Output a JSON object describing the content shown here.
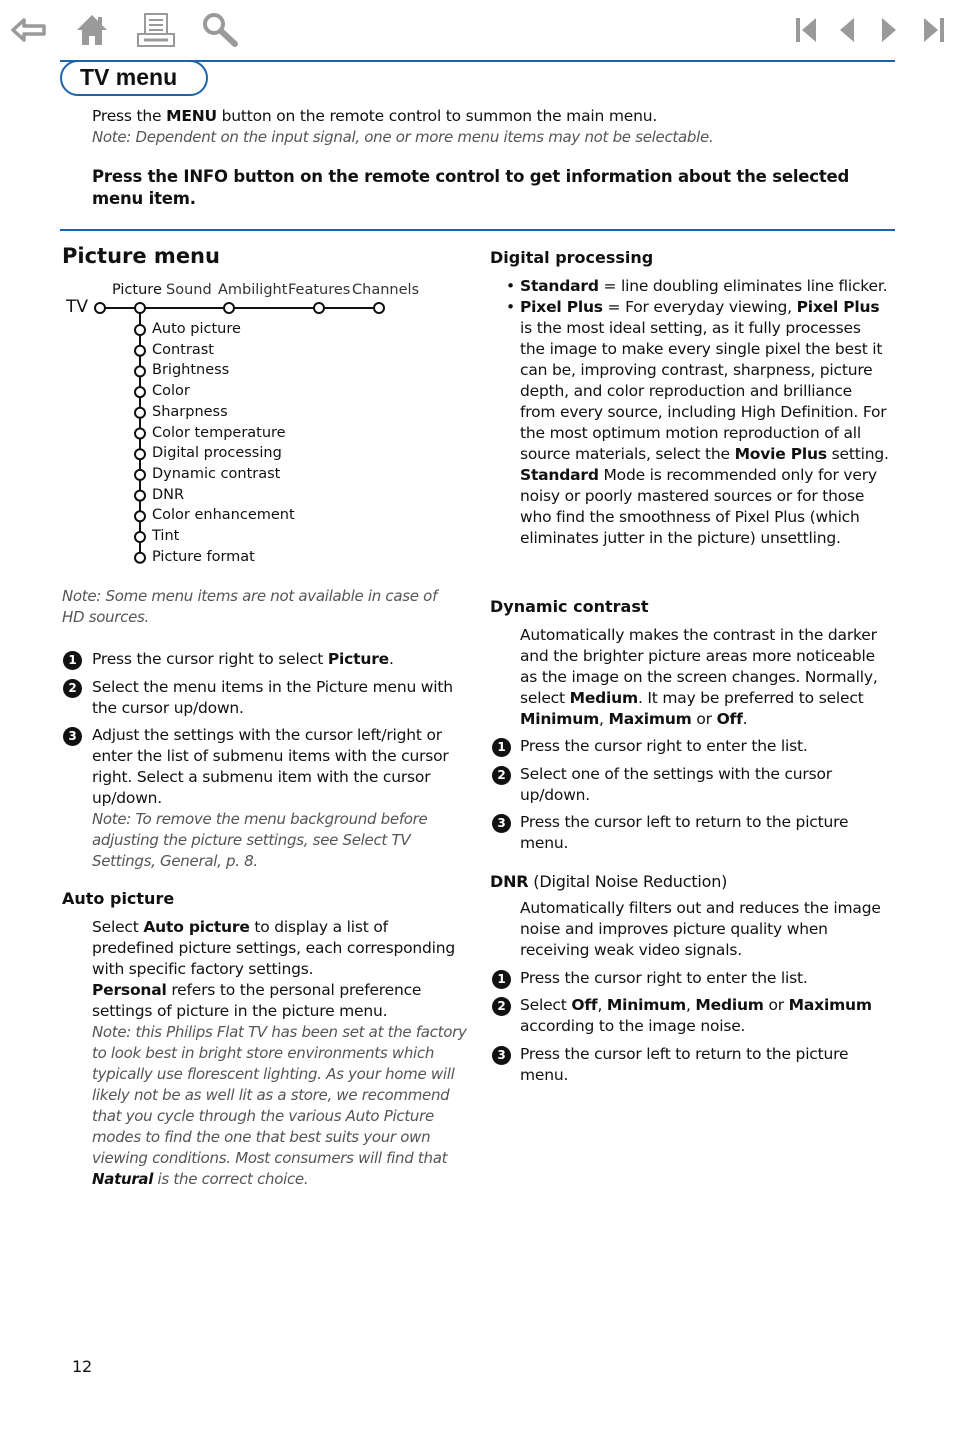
{
  "toolbar": {
    "left_icons": [
      "back-arrow-icon",
      "home-icon",
      "print-icon",
      "search-icon"
    ],
    "right_icons": [
      "first-page-icon",
      "previous-page-icon",
      "next-page-icon",
      "last-page-icon"
    ],
    "icon_color": "#9a9a9a"
  },
  "accent_color": "#1a63b0",
  "header": {
    "title": "TV menu",
    "intro_pre": "Press the ",
    "intro_key": "MENU",
    "intro_post": " button on the remote control to summon the main menu.",
    "intro_note": "Note: Dependent on the input signal, one or more menu items may not be selectable.",
    "info_text": "Press the INFO button on the remote control to get information about the selected menu item."
  },
  "picture_menu": {
    "heading": "Picture menu",
    "tree_root": "TV",
    "top_menu": [
      "Picture",
      "Sound",
      "Ambilight",
      "Features",
      "Channels"
    ],
    "items": [
      "Auto picture",
      "Contrast",
      "Brightness",
      "Color",
      "Sharpness",
      "Color temperature",
      "Digital processing",
      "Dynamic contrast",
      "DNR",
      "Color enhancement",
      "Tint",
      "Picture format"
    ],
    "note": "Note:  Some menu items are not available in case of HD sources.",
    "steps": [
      {
        "n": "1",
        "pre": "Press the cursor right to select ",
        "bold": "Picture",
        "post": "."
      },
      {
        "n": "2",
        "text": "Select the menu items in the Picture menu with the cursor up/down."
      },
      {
        "n": "3",
        "text": "Adjust the settings with the cursor left/right or enter the list of submenu items with the cursor right. Select a submenu item with the cursor up/down.",
        "note": "Note: To remove the menu background before adjusting the picture settings, see Select TV Settings, General, p. 8."
      }
    ]
  },
  "auto_picture": {
    "heading": "Auto picture",
    "p1_pre": "Select ",
    "p1_bold": "Auto picture",
    "p1_post": " to display a list of predefined picture settings, each corresponding with specific factory settings.",
    "p2_bold": "Personal",
    "p2_post": " refers to the personal preference settings of picture in the picture menu.",
    "note": "Note: this Philips Flat TV has been set at the factory to look best in bright store environments which typically use florescent lighting. As your home will likely not be as well lit as a store, we recommend that you cycle through the various Auto Picture modes to find the one that best suits your own viewing conditions. Most consumers will find that",
    "note_bold": "Natural",
    "note_post": " is the correct choice."
  },
  "digital_processing": {
    "heading": "Digital processing",
    "b1_bold": "Standard",
    "b1_text": " = line doubling eliminates line flicker.",
    "b2_bold": "Pixel Plus",
    "b2_a": " = For everyday viewing, ",
    "b2_bold2": "Pixel Plus",
    "b2_b": " is the most ideal setting, as it fully processes the image to make every single pixel the best it can be, improving contrast, sharpness, picture depth, and color reproduction and brilliance from every source, including High Definition. For the most optimum motion reproduction of all source materials, select the ",
    "b2_bold3": "Movie Plus",
    "b2_c": " setting. ",
    "b2_bold4": "Standard",
    "b2_d": " Mode is recommended only for very noisy or poorly mastered sources or for those who find the smoothness of Pixel Plus (which eliminates jutter in the picture) unsettling."
  },
  "dynamic_contrast": {
    "heading": "Dynamic contrast",
    "p_a": "Automatically makes the contrast in the darker and the brighter picture areas more noticeable as the image on the screen changes. Normally, select ",
    "p_b1": "Medium",
    "p_b": ". It may be preferred to select ",
    "p_b2": "Minimum",
    "p_c": ", ",
    "p_b3": "Maximum",
    "p_d": " or ",
    "p_b4": "Off",
    "p_e": ".",
    "steps": [
      {
        "n": "1",
        "text": "Press the cursor right to enter the list."
      },
      {
        "n": "2",
        "text": "Select one of the settings with the cursor up/down."
      },
      {
        "n": "3",
        "text": "Press the cursor left to return to the picture menu."
      }
    ]
  },
  "dnr": {
    "heading_bold": "DNR",
    "heading_rest": " (Digital Noise Reduction)",
    "p": "Automatically filters out and reduces the image noise and improves picture quality when receiving weak video signals.",
    "steps": [
      {
        "n": "1",
        "text": "Press the cursor right to enter the list."
      },
      {
        "n": "2",
        "pre": "Select ",
        "b1": "Off",
        "s1": ", ",
        "b2": "Minimum",
        "s2": ", ",
        "b3": "Medium",
        "s3": " or ",
        "b4": "Maximum",
        "post": " according to the image noise."
      },
      {
        "n": "3",
        "text": "Press the cursor left to return to the picture menu."
      }
    ]
  },
  "footer": {
    "page_number": "12"
  }
}
